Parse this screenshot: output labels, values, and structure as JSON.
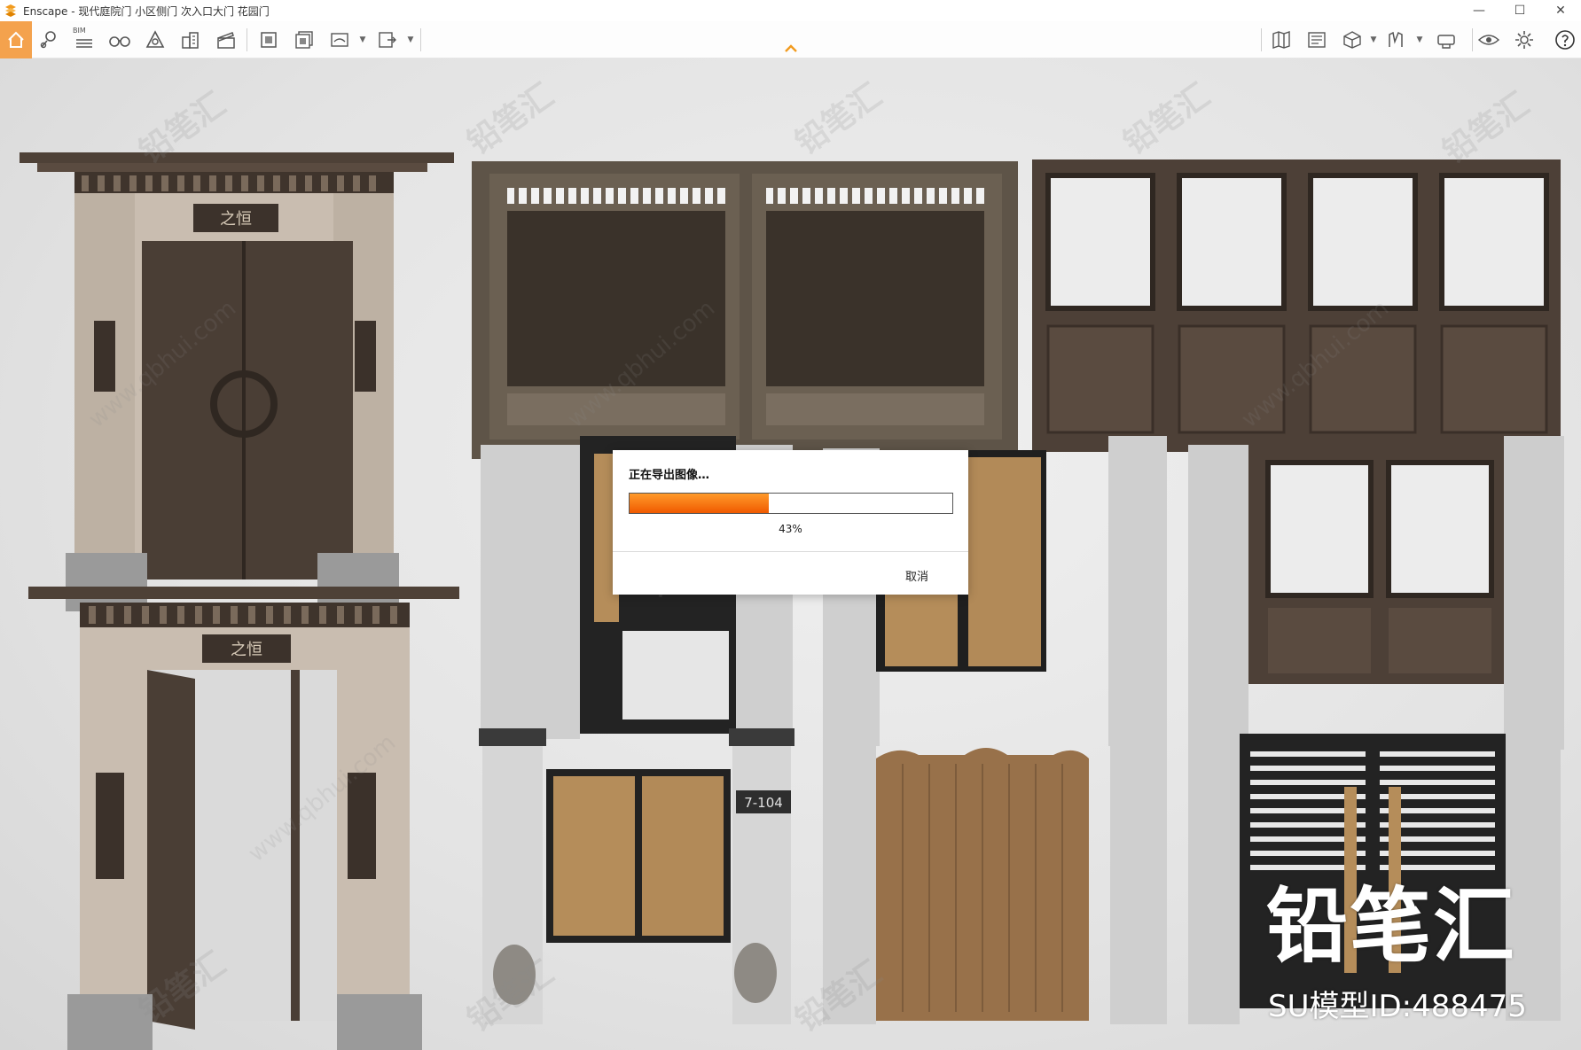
{
  "window": {
    "title": "Enscape - 现代庭院门 小区侧门 次入口大门 花园门",
    "minimize_glyph": "—",
    "maximize_glyph": "☐",
    "close_glyph": "✕"
  },
  "toolbar": {
    "bim_label": "BIM",
    "items": [
      "home-icon",
      "location-pin-icon",
      "bim-list-icon",
      "binoculars-icon",
      "asset-library-icon",
      "buildings-icon",
      "clapperboard-icon",
      "screenshot-icon",
      "batch-render-icon",
      "panorama-icon",
      "export-exe-icon",
      "map-icon",
      "views-icon",
      "cube-icon",
      "text-icon",
      "headset-icon",
      "eye-icon",
      "gear-icon",
      "help-icon"
    ]
  },
  "gate_labels": {
    "plaque_top": "之恒",
    "plaque_bottom": "之恒",
    "house_number": "7-104"
  },
  "dialog": {
    "title": "正在导出图像…",
    "progress": 43,
    "progress_text": "43%",
    "cancel_label": "取消"
  },
  "brand": {
    "logo_text": "铅笔汇",
    "model_id": "SU模型ID:488475",
    "watermark_text": "铅笔汇",
    "watermark_url": "www.qbhui.com"
  },
  "colors": {
    "accent": "#f4a24d",
    "progress": "#f26b00",
    "gate_dark": "#4a3e35",
    "wood": "#b58d5a"
  }
}
